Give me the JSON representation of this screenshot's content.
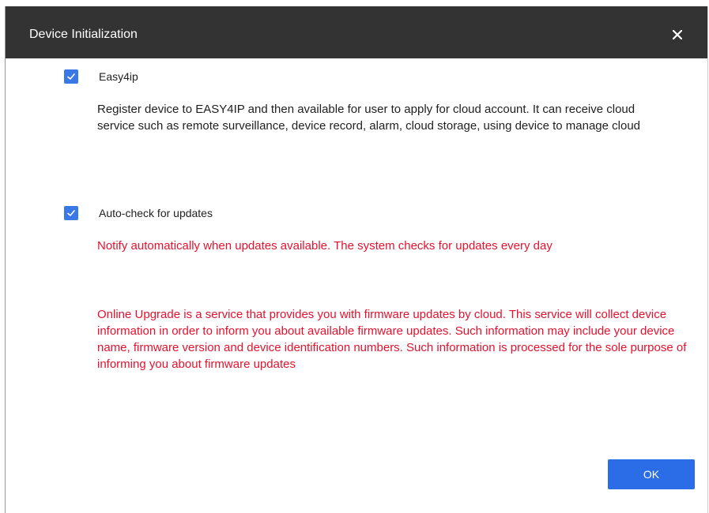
{
  "dialog": {
    "title": "Device Initialization",
    "close_glyph": "×"
  },
  "easy4ip": {
    "checked": true,
    "label": "Easy4ip",
    "description": "Register device to EASY4IP and then available for user to apply for cloud account. It can receive cloud service such as remote surveillance, device record, alarm, cloud storage, using device to manage cloud"
  },
  "autocheck": {
    "checked": true,
    "label": "Auto-check for updates",
    "notice": "Notify automatically when updates available. The system checks for updates every day",
    "online_upgrade": "Online Upgrade is a service that provides you with firmware updates by cloud. This service will collect device information in order to inform you about available firmware updates. Such information may include your device name, firmware version and device identification numbers. Such information is processed for the sole purpose of informing you about firmware updates"
  },
  "footer": {
    "ok_label": "OK"
  },
  "colors": {
    "title_bar": "#333333",
    "checkbox": "#3b78e7",
    "ok_button": "#2b6de6",
    "warning_text": "#e8112d"
  },
  "icons": {
    "close": "close-icon",
    "checkmark": "checkmark-icon"
  }
}
